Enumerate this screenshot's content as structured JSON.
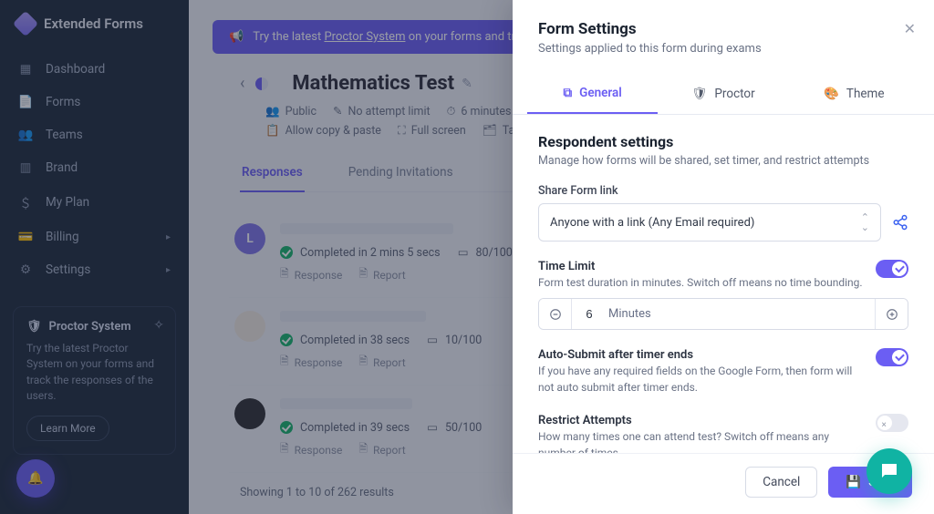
{
  "brand": {
    "name": "Extended Forms"
  },
  "sidebar": {
    "items": [
      {
        "label": "Dashboard"
      },
      {
        "label": "Forms"
      },
      {
        "label": "Teams"
      },
      {
        "label": "Brand"
      },
      {
        "label": "My Plan"
      },
      {
        "label": "Billing"
      },
      {
        "label": "Settings"
      }
    ],
    "promo": {
      "title": "Proctor System",
      "body": "Try the latest Proctor System on your forms and track the responses of the users.",
      "cta": "Learn More"
    }
  },
  "banner": {
    "prefix": "Try the latest ",
    "link": "Proctor System",
    "suffix": " on your forms and tr"
  },
  "form": {
    "title": "Mathematics Test",
    "meta": {
      "visibility": "Public",
      "attempts": "No attempt limit",
      "time": "6 minutes",
      "copy": "Allow copy & paste",
      "fullscreen": "Full screen",
      "tabswitch": "Tab switc"
    },
    "tabs": {
      "responses": "Responses",
      "pending": "Pending Invitations"
    }
  },
  "responses": [
    {
      "avatar_letter": "L",
      "status": "Completed in 2 mins 5 secs",
      "score": "80/100",
      "resp": "Response",
      "rep": "Report"
    },
    {
      "avatar_letter": "",
      "status": "Completed in 38 secs",
      "score": "10/100",
      "resp": "Response",
      "rep": "Report"
    },
    {
      "avatar_letter": "",
      "status": "Completed in 39 secs",
      "score": "50/100",
      "resp": "Response",
      "rep": "Report"
    }
  ],
  "results_count": "Showing 1 to 10 of 262 results",
  "panel": {
    "title": "Form Settings",
    "subtitle": "Settings applied to this form during exams",
    "tabs": {
      "general": "General",
      "proctor": "Proctor",
      "theme": "Theme"
    },
    "section": {
      "title": "Respondent settings",
      "sub": "Manage how forms will be shared, set timer, and restrict attempts"
    },
    "share": {
      "label": "Share Form link",
      "value": "Anyone with a link (Any Email required)"
    },
    "time": {
      "label": "Time Limit",
      "desc": "Form test duration in minutes. Switch off means no time bounding.",
      "value": "6",
      "unit": "Minutes"
    },
    "autosubmit": {
      "label": "Auto-Submit after timer ends",
      "desc": "If you have any required fields on the Google Form, then form will not auto submit after timer ends."
    },
    "restrict": {
      "label": "Restrict Attempts",
      "desc": "How many times one can attend test? Switch off means any number of times."
    },
    "footer": {
      "cancel": "Cancel",
      "save": "Save"
    }
  }
}
